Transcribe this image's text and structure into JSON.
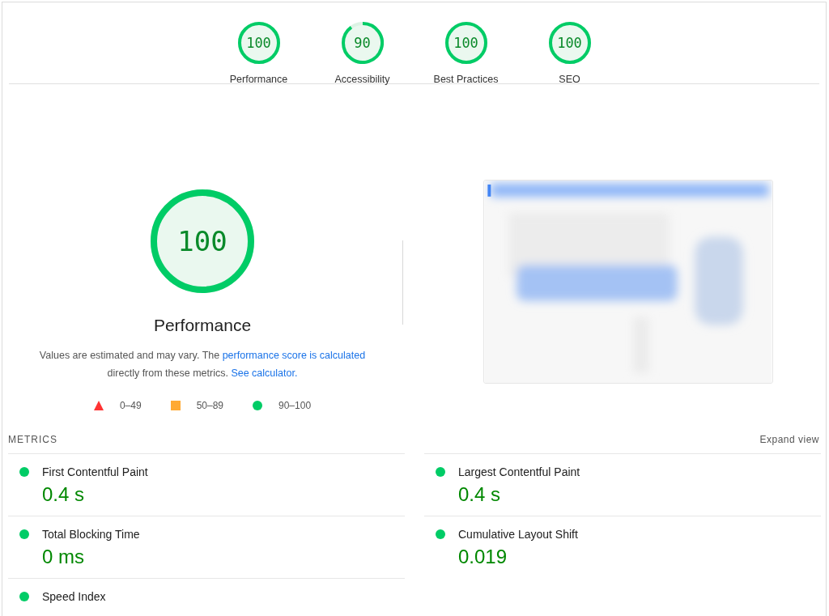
{
  "categories": [
    {
      "score": "100",
      "label": "Performance",
      "level": 1
    },
    {
      "score": "90",
      "label": "Accessibility",
      "level": 0.9
    },
    {
      "score": "100",
      "label": "Best Practices",
      "level": 1
    },
    {
      "score": "100",
      "label": "SEO",
      "level": 1
    }
  ],
  "hero": {
    "score": "100",
    "level": 1,
    "title": "Performance",
    "description": [
      {
        "text": "Values are estimated and may vary. The ",
        "kind": "text"
      },
      {
        "text": "performance score is calculated",
        "kind": "link"
      },
      {
        "text": " directly from these metrics. ",
        "kind": "text"
      },
      {
        "text": "See calculator.",
        "kind": "link"
      }
    ],
    "legend": [
      {
        "kind": "triangle",
        "color": "#ff3333",
        "label": "0–49"
      },
      {
        "kind": "square",
        "color": "#ffaa33",
        "label": "50–89"
      },
      {
        "kind": "circle",
        "color": "#00cc66",
        "label": "90–100"
      }
    ]
  },
  "metrics": {
    "title": "METRICS",
    "toggle": "Expand view",
    "items": [
      {
        "label": "First Contentful Paint",
        "value": "0.4 s",
        "color": "#00cc66"
      },
      {
        "label": "Largest Contentful Paint",
        "value": "0.4 s",
        "color": "#00cc66"
      },
      {
        "label": "Total Blocking Time",
        "value": "0 ms",
        "color": "#00cc66"
      },
      {
        "label": "Cumulative Layout Shift",
        "value": "0.019",
        "color": "#00cc66"
      },
      {
        "label": "Speed Index",
        "color": "#00cc66"
      }
    ]
  }
}
